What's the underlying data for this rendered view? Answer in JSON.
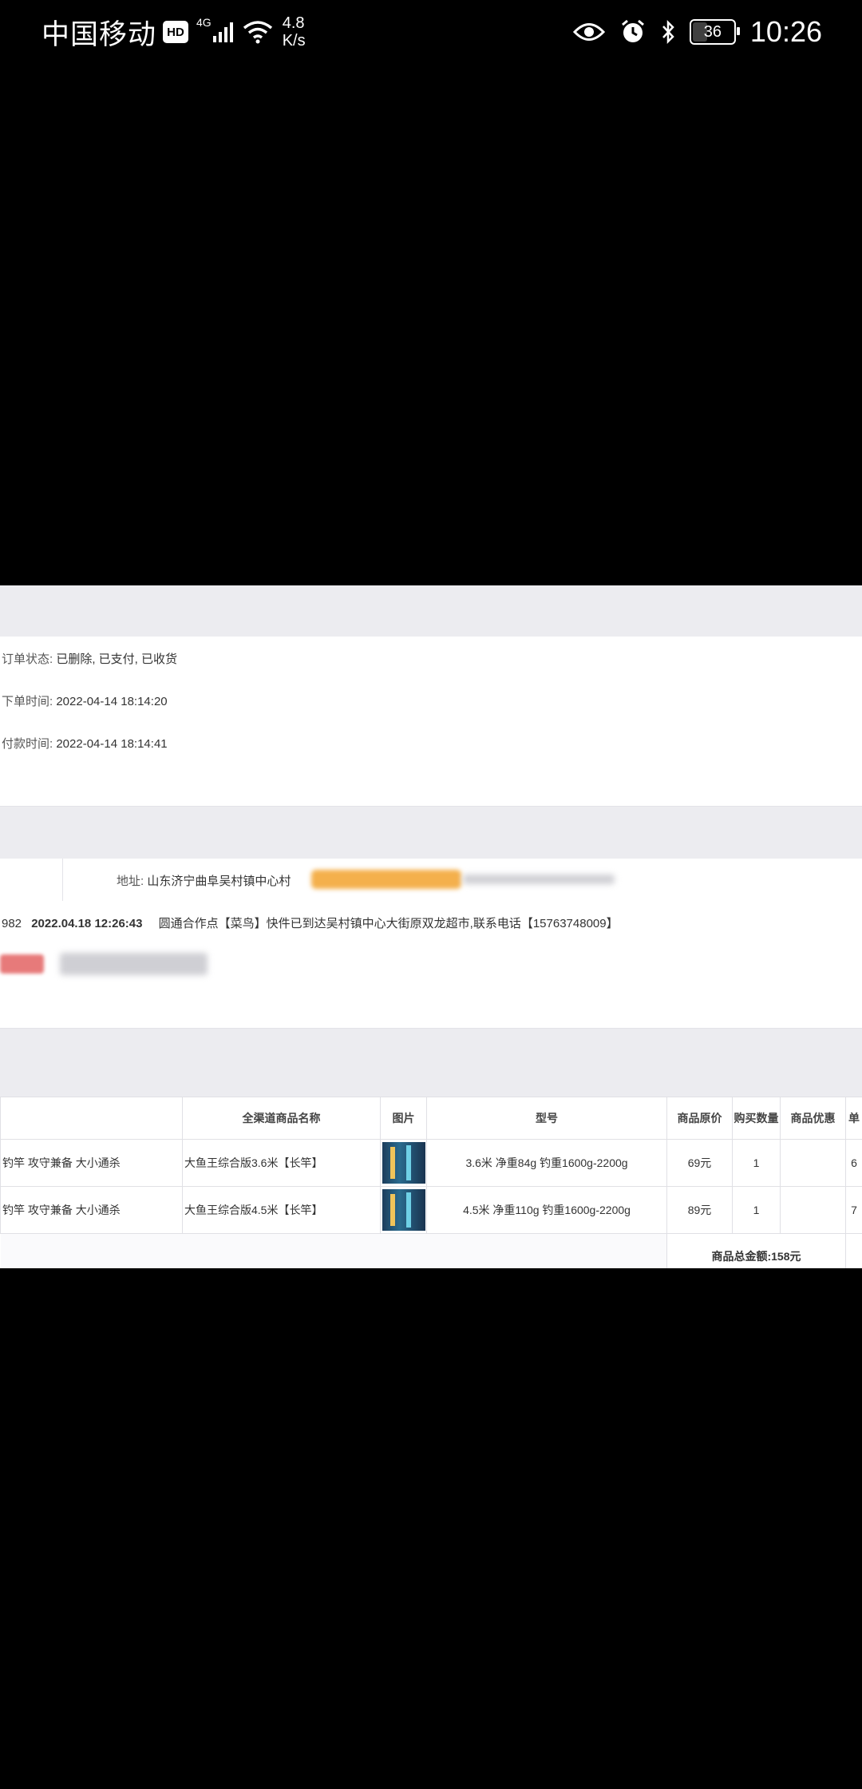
{
  "status_bar": {
    "carrier": "中国移动",
    "hd": "HD",
    "network": "4G",
    "speed_value": "4.8",
    "speed_unit": "K/s",
    "battery": "36",
    "time": "10:26"
  },
  "order": {
    "status_label": "订单状态:",
    "status_value": "已删除, 已支付, 已收货",
    "created_label": "下单时间:",
    "created_value": "2022-04-14 18:14:20",
    "paid_label": "付款时间:",
    "paid_value": "2022-04-14 18:14:41"
  },
  "shipping": {
    "address_label": "地址:",
    "address_value": "山东济宁曲阜吴村镇中心村",
    "tracking_prefix": "982",
    "tracking_time": "2022.04.18 12:26:43",
    "tracking_message": "圆通合作点【菜鸟】快件已到达吴村镇中心大街原双龙超市,联系电话【15763748009】"
  },
  "table": {
    "headers": [
      "",
      "全渠道商品名称",
      "图片",
      "型号",
      "商品原价",
      "购买数量",
      "商品优惠",
      "单"
    ],
    "rows": [
      {
        "col1": "钓竿 攻守兼备 大小通杀",
        "name": "大鱼王综合版3.6米【长竿】",
        "model": "3.6米 净重84g 钓重1600g-2200g",
        "price": "69元",
        "qty": "1",
        "discount": "",
        "partial": "6"
      },
      {
        "col1": "钓竿 攻守兼备 大小通杀",
        "name": "大鱼王综合版4.5米【长竿】",
        "model": "4.5米 净重110g 钓重1600g-2200g",
        "price": "89元",
        "qty": "1",
        "discount": "",
        "partial": "7"
      }
    ],
    "total": "商品总金额:158元"
  }
}
